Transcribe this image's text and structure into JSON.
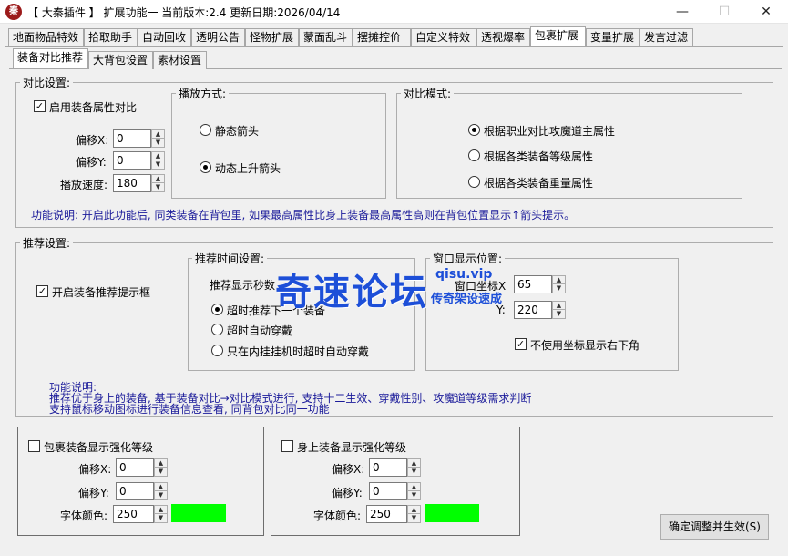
{
  "window": {
    "title": "【 大秦插件 】 扩展功能一 当前版本:2.4 更新日期:2026/04/14",
    "minimize": "—",
    "maximize": "☐",
    "close": "✕",
    "logo": "秦"
  },
  "main_tabs": [
    "地面物品特效",
    "拾取助手",
    "自动回收",
    "透明公告",
    "怪物扩展",
    "蒙面乱斗",
    "摆摊控价",
    "自定义特效",
    "透视爆率",
    "包裹扩展",
    "变量扩展",
    "发言过滤"
  ],
  "sub_tabs": [
    "装备对比推荐",
    "大背包设置",
    "素材设置"
  ],
  "compare": {
    "legend": "对比设置:",
    "enable_label": "启用装备属性对比",
    "enable_checked": true,
    "offset_x_label": "偏移X:",
    "offset_x": "0",
    "offset_y_label": "偏移Y:",
    "offset_y": "0",
    "speed_label": "播放速度:",
    "speed": "180",
    "play_mode": {
      "legend": "播放方式:",
      "options": [
        "静态箭头",
        "动态上升箭头"
      ],
      "selected": 1
    },
    "compare_mode": {
      "legend": "对比模式:",
      "options": [
        "根据职业对比攻魔道主属性",
        "根据各类装备等级属性",
        "根据各类装备重量属性"
      ],
      "selected": 0
    },
    "description": "功能说明: 开启此功能后, 同类装备在背包里, 如果最高属性比身上装备最高属性高则在背包位置显示↑箭头提示。"
  },
  "recommend": {
    "legend": "推荐设置:",
    "enable_label": "开启装备推荐提示框",
    "enable_checked": true,
    "time": {
      "legend": "推荐时间设置:",
      "display_label": "推荐显示秒数",
      "options": [
        "超时推荐下一个装备",
        "超时自动穿戴",
        "只在内挂挂机时超时自动穿戴"
      ],
      "selected": 0
    },
    "position": {
      "legend": "窗口显示位置:",
      "x_label": "窗口坐标X",
      "x": "65",
      "y_label": "Y:",
      "y": "220",
      "bottom_right_label": "不使用坐标显示右下角",
      "bottom_right_checked": true
    },
    "description_title": "功能说明:",
    "description_1": "推荐优于身上的装备, 基于装备对比→对比模式进行, 支持十二生效、穿戴性别、攻魔道等级需求判断",
    "description_2": "支持鼠标移动图标进行装备信息查看, 同背包对比同一功能"
  },
  "bag_strength": {
    "label": "包裹装备显示强化等级",
    "checked": false,
    "offset_x_label": "偏移X:",
    "offset_x": "0",
    "offset_y_label": "偏移Y:",
    "offset_y": "0",
    "color_label": "字体颜色:",
    "color_value": "250",
    "swatch_color": "#00ff00"
  },
  "body_strength": {
    "label": "身上装备显示强化等级",
    "checked": false,
    "offset_x_label": "偏移X:",
    "offset_x": "0",
    "offset_y_label": "偏移Y:",
    "offset_y": "0",
    "color_label": "字体颜色:",
    "color_value": "250",
    "swatch_color": "#00ff00"
  },
  "apply_button": "确定调整并生效(S)",
  "watermark": {
    "main": "奇速论坛",
    "url": "qisu.vip",
    "sub": "传奇架设速成"
  }
}
